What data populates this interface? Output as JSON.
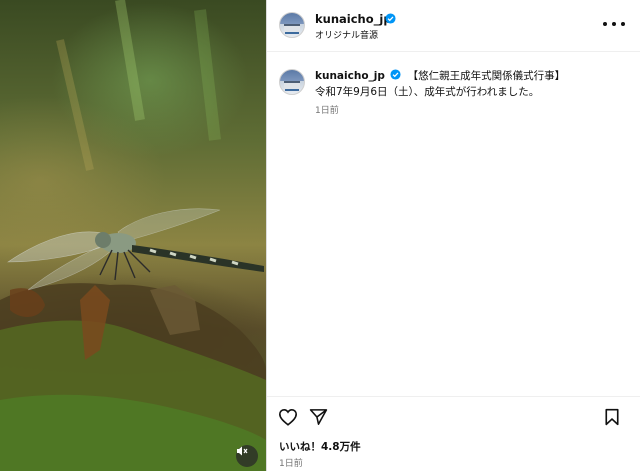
{
  "post": {
    "username": "kunaicho_jp",
    "audio_label": "オリジナル音源",
    "caption_title": "【悠仁親王成年式関係儀式行事】",
    "caption_body": "令和7年9月6日（土）、成年式が行われました。",
    "caption_time": "1日前",
    "likes": "いいね！4.8万件",
    "post_time": "1日前"
  },
  "icons": {
    "verified": "verified-badge-icon",
    "more": "more-options-icon",
    "like": "heart-icon",
    "share": "share-icon",
    "save": "bookmark-icon",
    "mute": "speaker-muted-icon"
  },
  "colors": {
    "verified_blue": "#0095f6",
    "secondary_text": "#737373",
    "border": "#dbdbdb"
  }
}
